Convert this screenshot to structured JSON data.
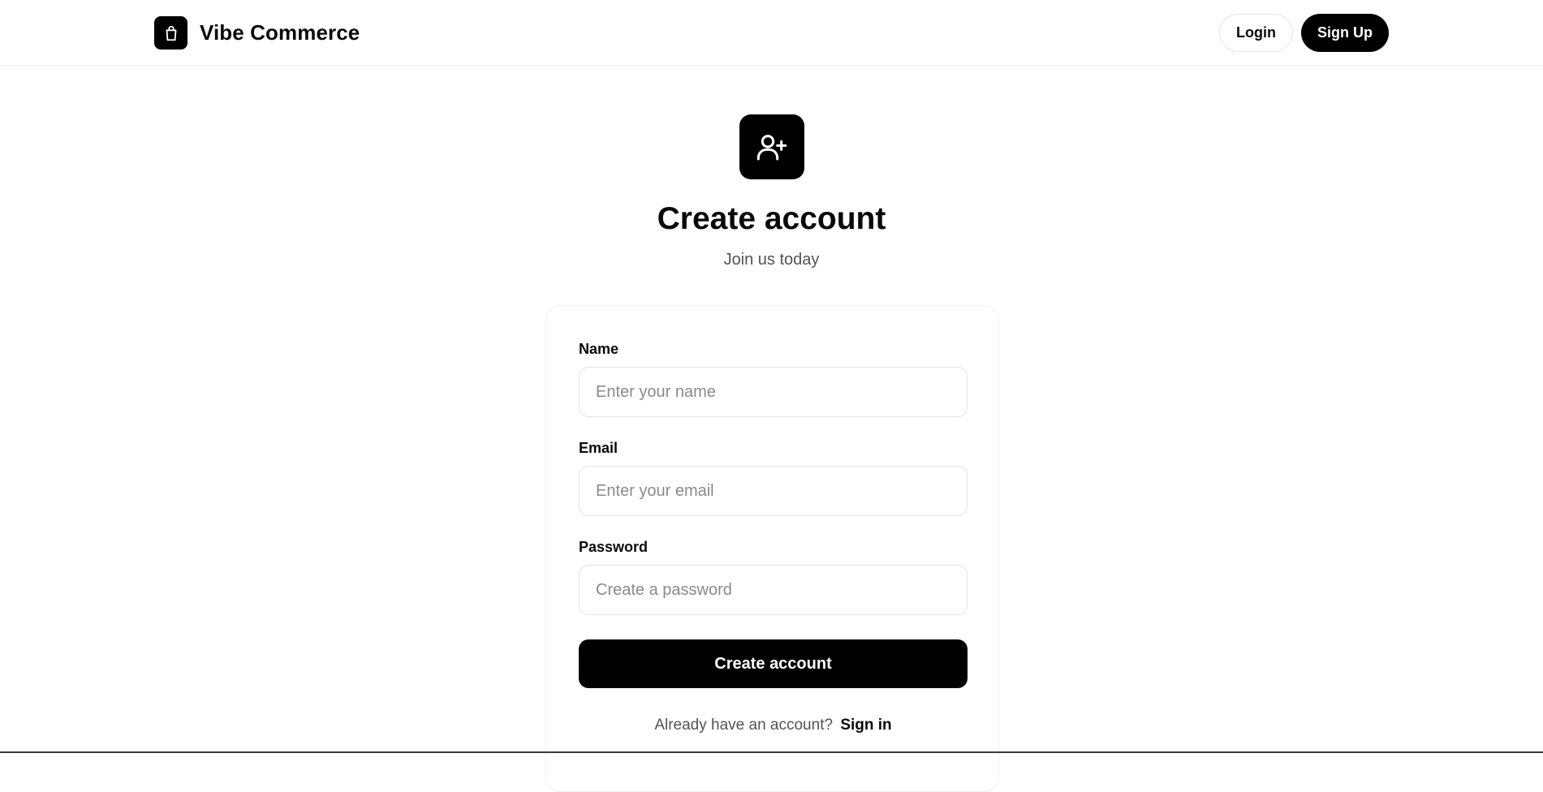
{
  "header": {
    "brand_name": "Vibe Commerce",
    "brand_icon": "shopping-bag-icon",
    "login_label": "Login",
    "signup_label": "Sign Up"
  },
  "hero": {
    "icon": "user-plus-icon",
    "title": "Create account",
    "subtitle": "Join us today"
  },
  "form": {
    "name": {
      "label": "Name",
      "placeholder": "Enter your name",
      "value": ""
    },
    "email": {
      "label": "Email",
      "placeholder": "Enter your email",
      "value": ""
    },
    "password": {
      "label": "Password",
      "placeholder": "Create a password",
      "value": ""
    },
    "submit_label": "Create account",
    "signin_prompt": "Already have an account?",
    "signin_link": "Sign in"
  },
  "colors": {
    "primary": "#000000",
    "background": "#ffffff",
    "muted_text": "#52525b",
    "border": "#e4e4e7"
  }
}
